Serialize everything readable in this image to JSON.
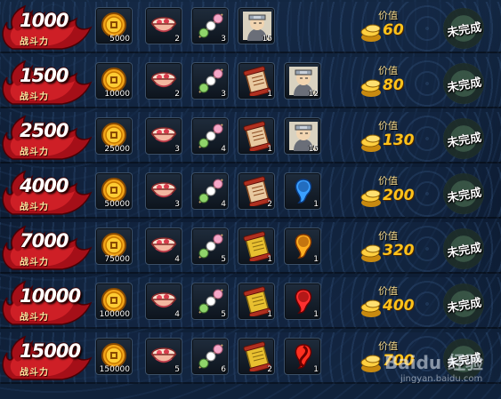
{
  "labels": {
    "power": "战斗力",
    "value": "价值",
    "status": "未完成"
  },
  "item_icons": [
    "coin-icon",
    "ramen-bowl-icon",
    "dango-icon",
    "scroll-or-ninja-icon",
    "ninja-or-gem-icon"
  ],
  "rows": [
    {
      "power": "1000",
      "coin": "5000",
      "ramen": "2",
      "dango": "3",
      "slot4": "15",
      "slot4_icon": "ninja-portrait-icon",
      "slot5": "",
      "slot5_icon": "",
      "value": "60"
    },
    {
      "power": "1500",
      "coin": "10000",
      "ramen": "2",
      "dango": "3",
      "slot4": "1",
      "slot4_icon": "scroll-icon",
      "slot5": "12",
      "slot5_icon": "ninja-portrait-icon",
      "value": "80"
    },
    {
      "power": "2500",
      "coin": "25000",
      "ramen": "3",
      "dango": "4",
      "slot4": "1",
      "slot4_icon": "scroll-icon",
      "slot5": "15",
      "slot5_icon": "ninja-portrait-icon",
      "value": "130"
    },
    {
      "power": "4000",
      "coin": "50000",
      "ramen": "3",
      "dango": "4",
      "slot4": "2",
      "slot4_icon": "scroll-icon",
      "slot5": "1",
      "slot5_icon": "blue-magatama-icon",
      "value": "200"
    },
    {
      "power": "7000",
      "coin": "75000",
      "ramen": "4",
      "dango": "5",
      "slot4": "1",
      "slot4_icon": "gold-scroll-icon",
      "slot5": "1",
      "slot5_icon": "orange-magatama-icon",
      "value": "320"
    },
    {
      "power": "10000",
      "coin": "100000",
      "ramen": "4",
      "dango": "5",
      "slot4": "1",
      "slot4_icon": "gold-scroll-icon",
      "slot5": "1",
      "slot5_icon": "red-magatama-icon",
      "value": "400"
    },
    {
      "power": "15000",
      "coin": "150000",
      "ramen": "5",
      "dango": "6",
      "slot4": "2",
      "slot4_icon": "gold-scroll-icon",
      "slot5": "1",
      "slot5_icon": "swirl-magatama-icon",
      "value": "700"
    }
  ],
  "watermark": {
    "main": "Baidu 经验",
    "sub": "jingyan.baidu.com"
  },
  "colors": {
    "value_gold": "#ffc21a",
    "power_flame": "#b0121a"
  }
}
